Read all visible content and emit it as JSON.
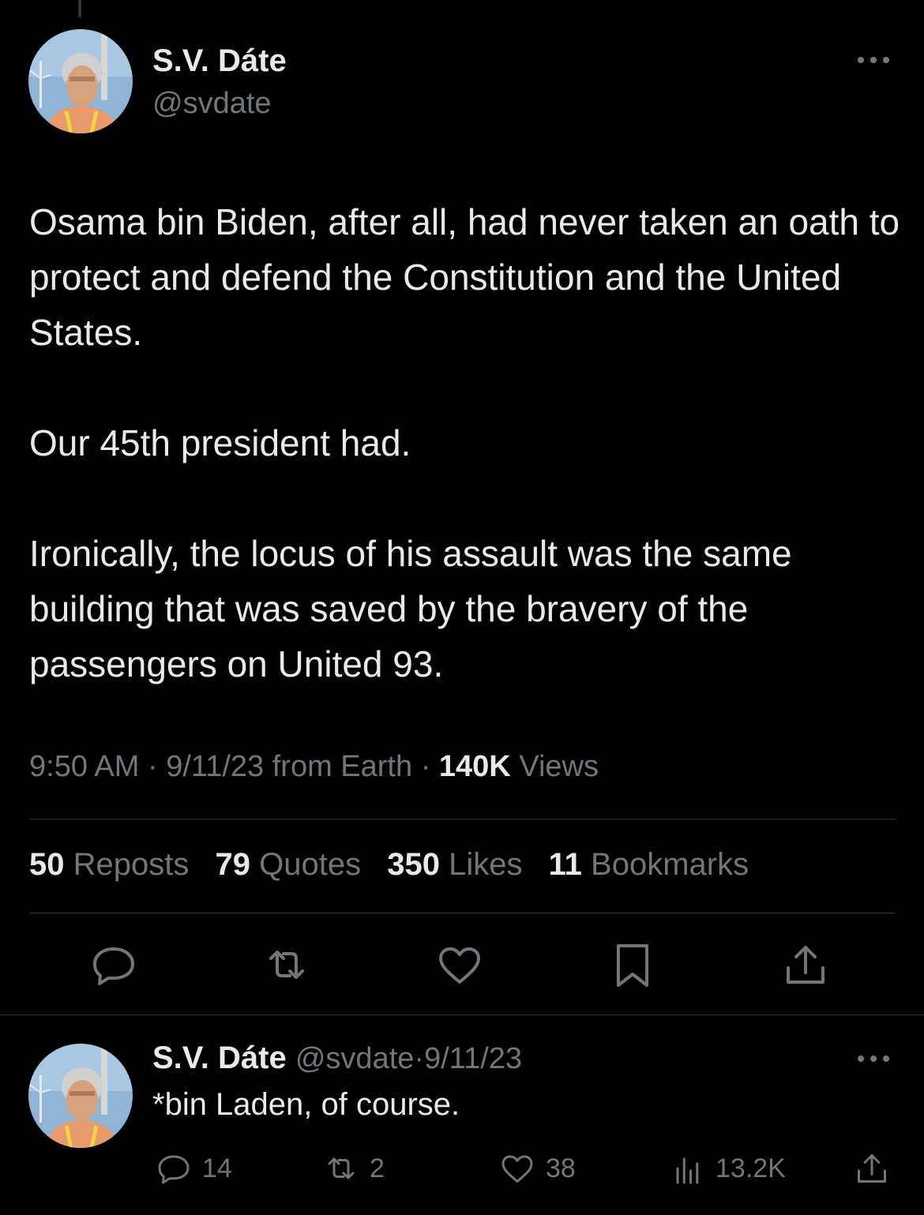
{
  "main_tweet": {
    "display_name": "S.V. Dáte",
    "handle": "@svdate",
    "paragraphs": [
      "Osama bin Biden, after all, had never taken an oath to protect and defend the Constitution and the United States.",
      "Our 45th president had.",
      "Ironically, the locus of his assault was the same building that was saved by the bravery of the passengers on United 93."
    ],
    "time": "9:50 AM",
    "date": "9/11/23",
    "source": "from Earth",
    "views_count": "140K",
    "views_label": "Views",
    "separator": "·"
  },
  "stats": [
    {
      "count": "50",
      "label": "Reposts"
    },
    {
      "count": "79",
      "label": "Quotes"
    },
    {
      "count": "350",
      "label": "Likes"
    },
    {
      "count": "11",
      "label": "Bookmarks"
    }
  ],
  "actions": [
    "reply-icon",
    "repost-icon",
    "like-icon",
    "bookmark-icon",
    "share-icon"
  ],
  "reply_tweet": {
    "display_name": "S.V. Dáte",
    "handle": "@svdate",
    "separator": "·",
    "date": "9/11/23",
    "text": "*bin Laden, of course.",
    "reply_count": "14",
    "repost_count": "2",
    "like_count": "38",
    "views_count": "13.2K"
  },
  "colors": {
    "background": "#000000",
    "primary_text": "#e7e9ea",
    "secondary_text": "#71767b",
    "divider": "#2f3336"
  }
}
